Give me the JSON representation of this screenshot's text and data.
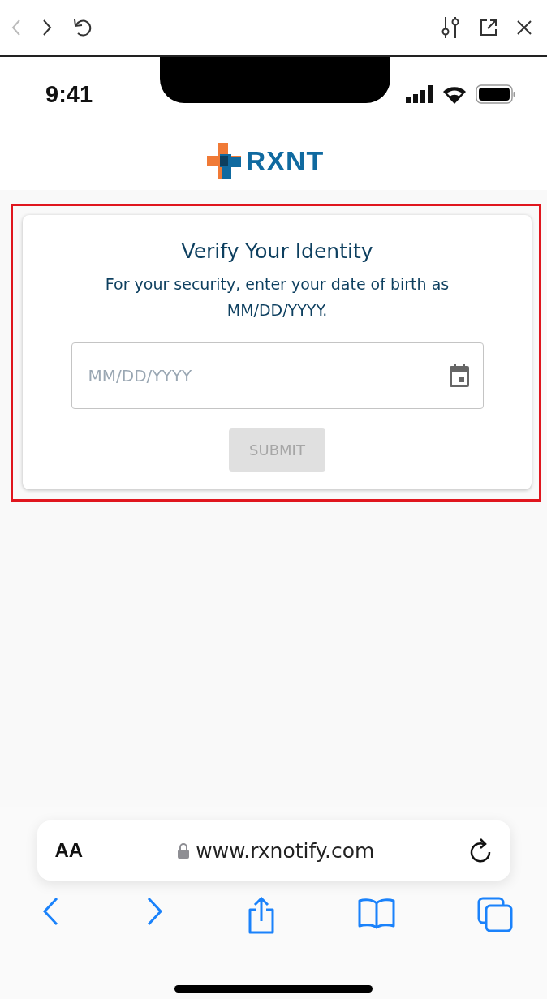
{
  "status_bar": {
    "time": "9:41"
  },
  "logo": {
    "text": "RXNT"
  },
  "card": {
    "title": "Verify Your Identity",
    "message": "For your security, enter your date of birth as MM/DD/YYYY.",
    "date_field": {
      "placeholder": "MM/DD/YYYY"
    },
    "submit": {
      "label": "SUBMIT",
      "disabled": true
    }
  },
  "address_bar": {
    "text_size": "AA",
    "url": "www.rxnotify.com"
  }
}
